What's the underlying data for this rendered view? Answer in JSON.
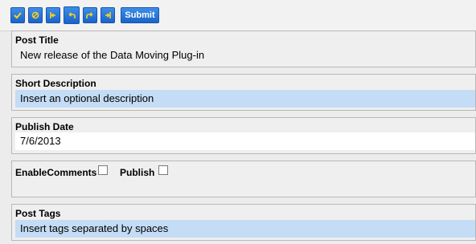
{
  "toolbar": {
    "buttons": [
      {
        "name": "check",
        "icon": "check-icon"
      },
      {
        "name": "cancel",
        "icon": "cancel-icon"
      },
      {
        "name": "first",
        "icon": "first-icon"
      },
      {
        "name": "undo",
        "icon": "undo-icon"
      },
      {
        "name": "redo",
        "icon": "redo-icon"
      },
      {
        "name": "last",
        "icon": "last-icon"
      }
    ],
    "submit_label": "Submit"
  },
  "fields": {
    "post_title": {
      "label": "Post Title",
      "value": "New release of the Data Moving Plug-in"
    },
    "short_description": {
      "label": "Short Description",
      "placeholder": "Insert an optional description"
    },
    "publish_date": {
      "label": "Publish Date",
      "value": "7/6/2013"
    },
    "enable_comments": {
      "label": "EnableComments",
      "checked": false
    },
    "publish": {
      "label": "Publish",
      "checked": false
    },
    "post_tags": {
      "label": "Post Tags",
      "placeholder": "Insert tags separated by spaces"
    }
  },
  "colors": {
    "accent": "#1a64c8",
    "icon": "#ffd21f",
    "input_highlight": "#c4dcf5"
  }
}
